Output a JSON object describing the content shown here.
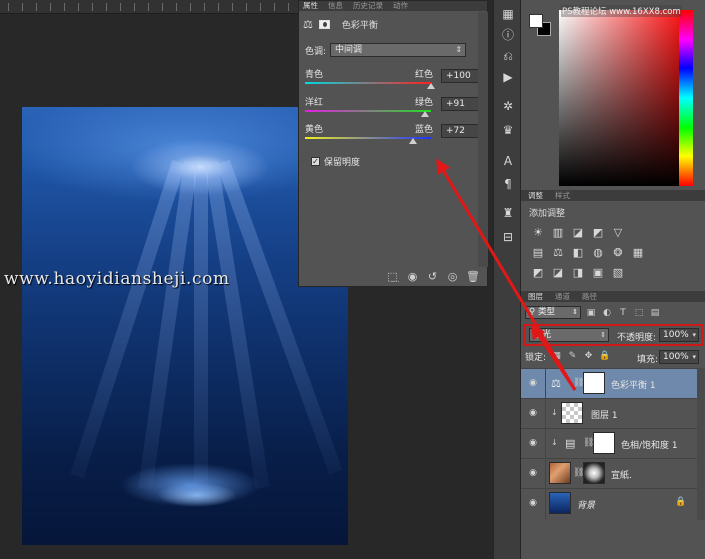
{
  "watermark": "www.haoyidiansheji.com",
  "site_tag": "PS教程论坛 www.16XX8.com",
  "properties": {
    "tabs": [
      "属性",
      "信息",
      "历史记录",
      "动作"
    ],
    "title": "色彩平衡",
    "tone_label": "色调:",
    "tone_value": "中间调",
    "sliders": [
      {
        "left": "青色",
        "right": "红色",
        "value": "+100",
        "fraction": 1.0
      },
      {
        "left": "洋红",
        "right": "绿色",
        "value": "+91",
        "fraction": 0.955
      },
      {
        "left": "黄色",
        "right": "蓝色",
        "value": "+72",
        "fraction": 0.86
      }
    ],
    "preserve_label": "保留明度"
  },
  "adjustments": {
    "tabs": [
      "调整",
      "样式"
    ],
    "title": "添加调整"
  },
  "layers": {
    "tabs": [
      "图层",
      "通道",
      "路径"
    ],
    "kind_value": "类型",
    "blend_mode": "柔光",
    "opacity_label": "不透明度:",
    "opacity_value": "100%",
    "lock_label": "锁定:",
    "fill_label": "填充:",
    "fill_value": "100%",
    "rows": [
      {
        "name": "色彩平衡 1"
      },
      {
        "name": "图层 1"
      },
      {
        "name": "色相/饱和度 1"
      },
      {
        "name": "宣紙."
      },
      {
        "name": "背景"
      }
    ]
  },
  "colors": {
    "accent_red": "#d01818",
    "panel_bg": "#535353",
    "selected_row": "#6e89ab"
  }
}
